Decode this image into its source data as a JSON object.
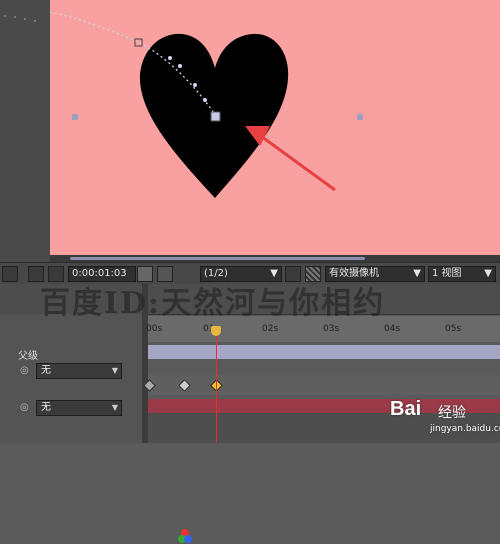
{
  "toolbar": {
    "timecode": "0:00:01:03",
    "resolution": "(1/2)",
    "camera": "有效摄像机",
    "view": "1 视图"
  },
  "timeline": {
    "ruler_labels": [
      "00s",
      "01s",
      "02s",
      "03s",
      "04s",
      "05s"
    ],
    "parent_header": "父级"
  },
  "layers": [
    {
      "parent_value": "无"
    },
    {
      "parent_value": "无"
    }
  ],
  "watermark": {
    "text": "百度ID:天然河与你相约",
    "logo": "Bai 经验",
    "logo_brand": "Bai",
    "logo_sub": "经验",
    "url": "jingyan.baidu.com"
  },
  "colors": {
    "composition_bg": "#f9a0a0",
    "arrow": "#e84040",
    "playhead": "#e03030",
    "track_layer1": "#a5a5c6",
    "track_layer2": "#9a3a48"
  },
  "icons": [
    "heart-shape",
    "motion-path",
    "red-arrow-annotation",
    "camera-icon",
    "color-channel-icon",
    "eye-icon",
    "keyframe-icon",
    "playhead-icon"
  ]
}
